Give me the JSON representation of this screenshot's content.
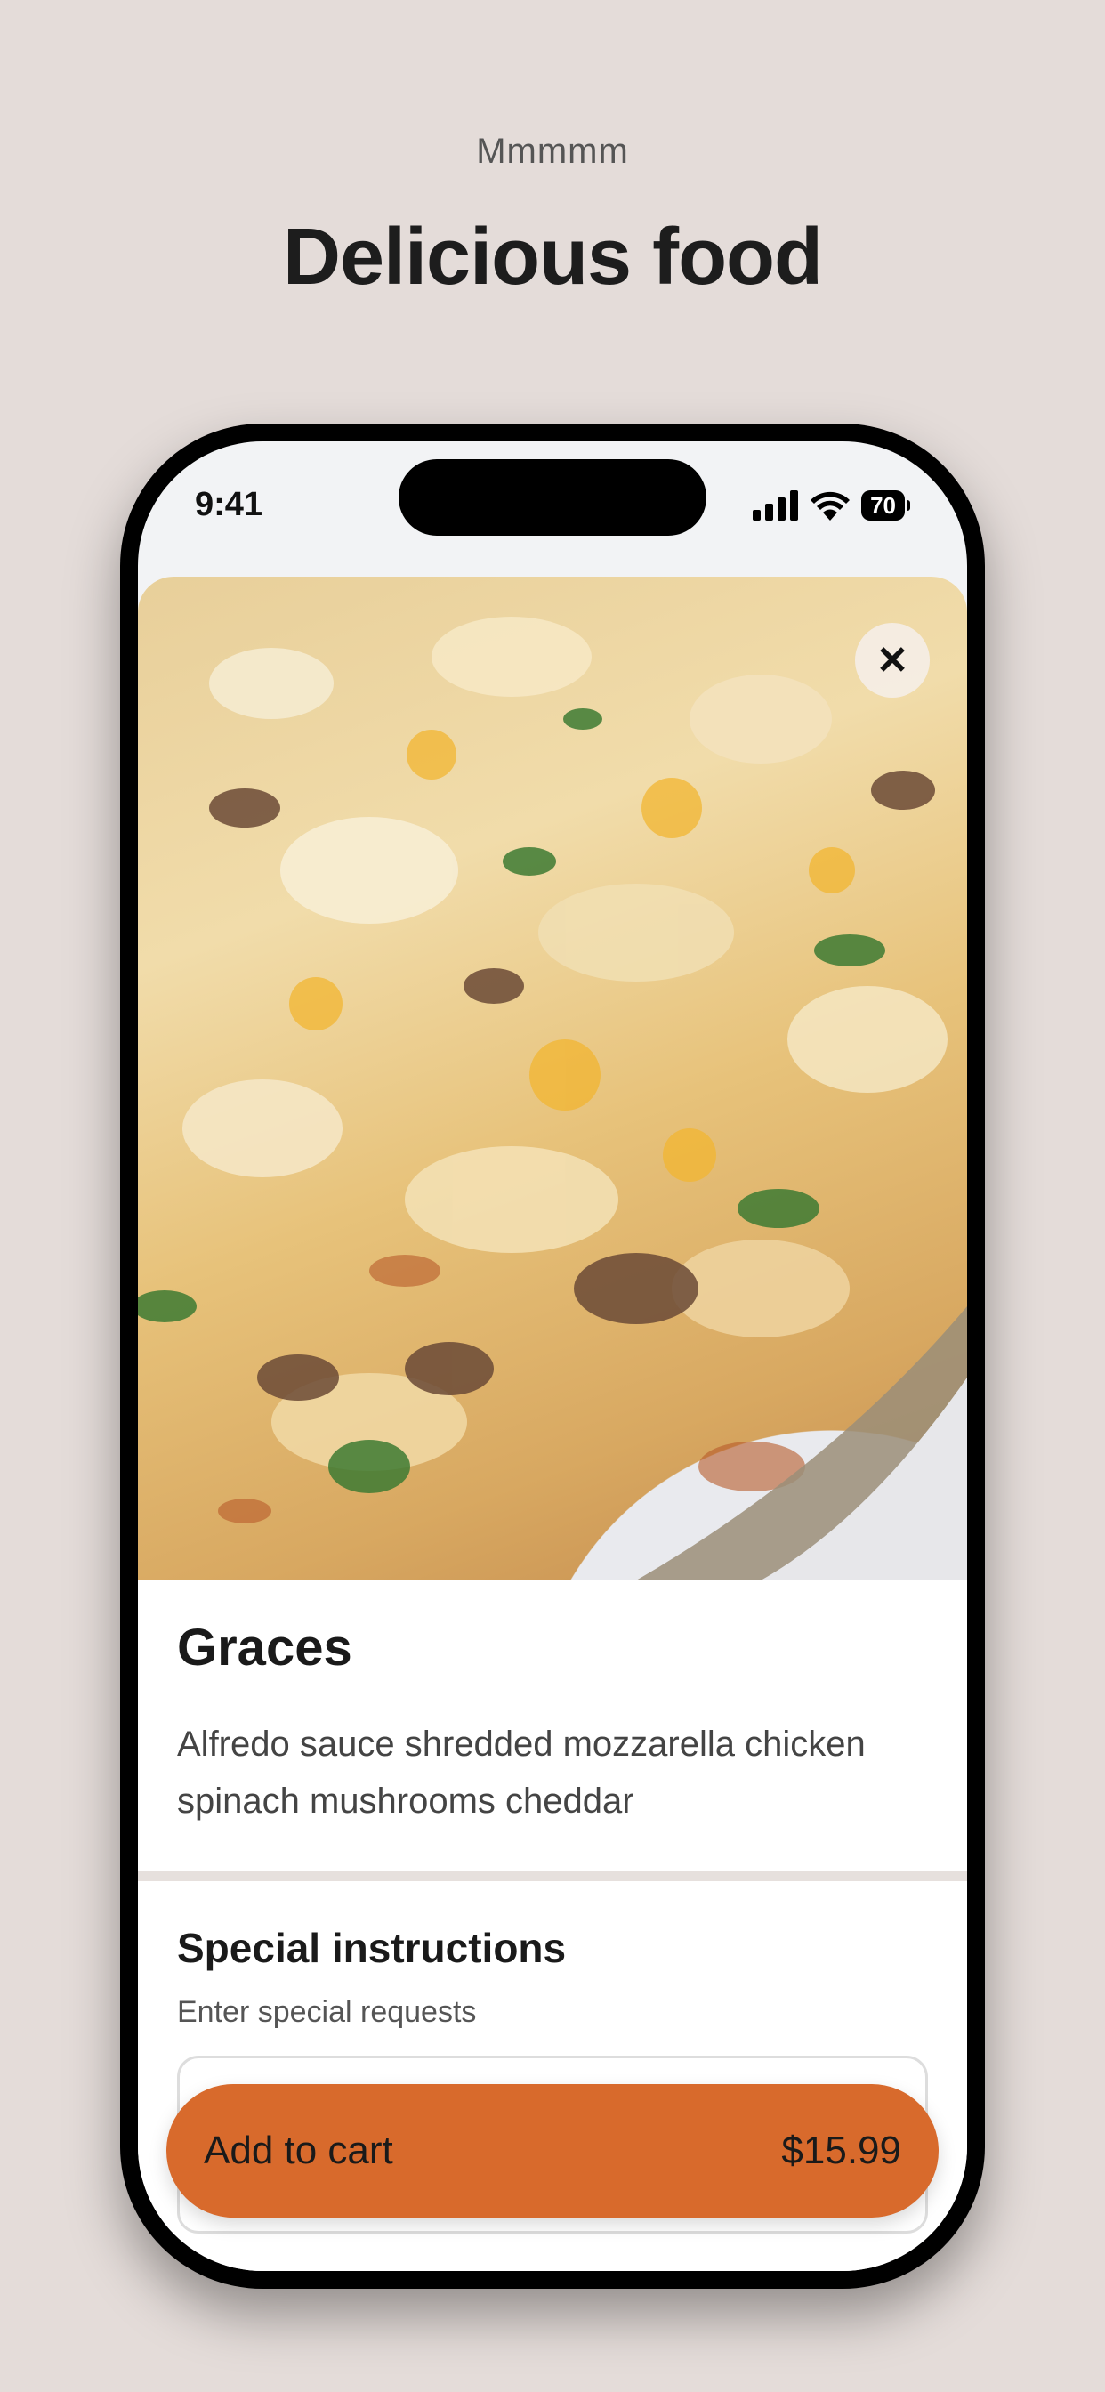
{
  "promo": {
    "eyebrow": "Mmmmm",
    "title": "Delicious food"
  },
  "status_bar": {
    "time": "9:41",
    "battery": "70",
    "icons": [
      "signal-icon",
      "wifi-icon",
      "battery-icon"
    ]
  },
  "item": {
    "image": "pizza-photo",
    "close_icon": "close-icon",
    "name": "Graces",
    "description": "Alfredo sauce shredded mozzarella chicken spinach mushrooms cheddar"
  },
  "special_instructions": {
    "title": "Special instructions",
    "hint": "Enter special requests",
    "value": ""
  },
  "cart": {
    "label": "Add to cart",
    "price": "$15.99"
  },
  "colors": {
    "background": "#e4dcd9",
    "accent": "#d86a2c"
  }
}
